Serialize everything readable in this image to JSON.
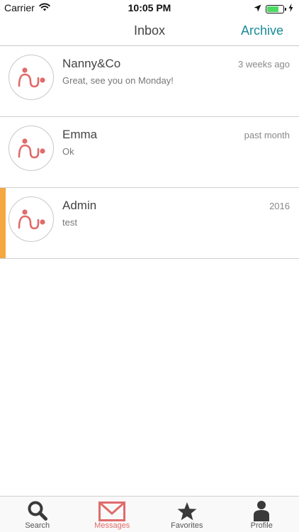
{
  "status_bar": {
    "carrier": "Carrier",
    "time": "10:05 PM",
    "battery_level": 0.75
  },
  "nav": {
    "title": "Inbox",
    "archive_label": "Archive"
  },
  "colors": {
    "accent": "#1a8a96",
    "brand": "#e06b6b",
    "unread": "#f5a742"
  },
  "conversations": [
    {
      "name": "Nanny&Co",
      "preview": "Great, see you on Monday!",
      "time": "3 weeks ago",
      "unread": false,
      "avatar_icon": "app-logo-icon"
    },
    {
      "name": "Emma",
      "preview": "Ok",
      "time": "past month",
      "unread": false,
      "avatar_icon": "app-logo-icon"
    },
    {
      "name": "Admin",
      "preview": "test",
      "time": "2016",
      "unread": true,
      "avatar_icon": "app-logo-icon"
    }
  ],
  "tabs": [
    {
      "label": "Search",
      "icon": "search-icon",
      "active": false
    },
    {
      "label": "Messages",
      "icon": "mail-icon",
      "active": true
    },
    {
      "label": "Favorites",
      "icon": "star-icon",
      "active": false
    },
    {
      "label": "Profile",
      "icon": "person-icon",
      "active": false
    }
  ]
}
